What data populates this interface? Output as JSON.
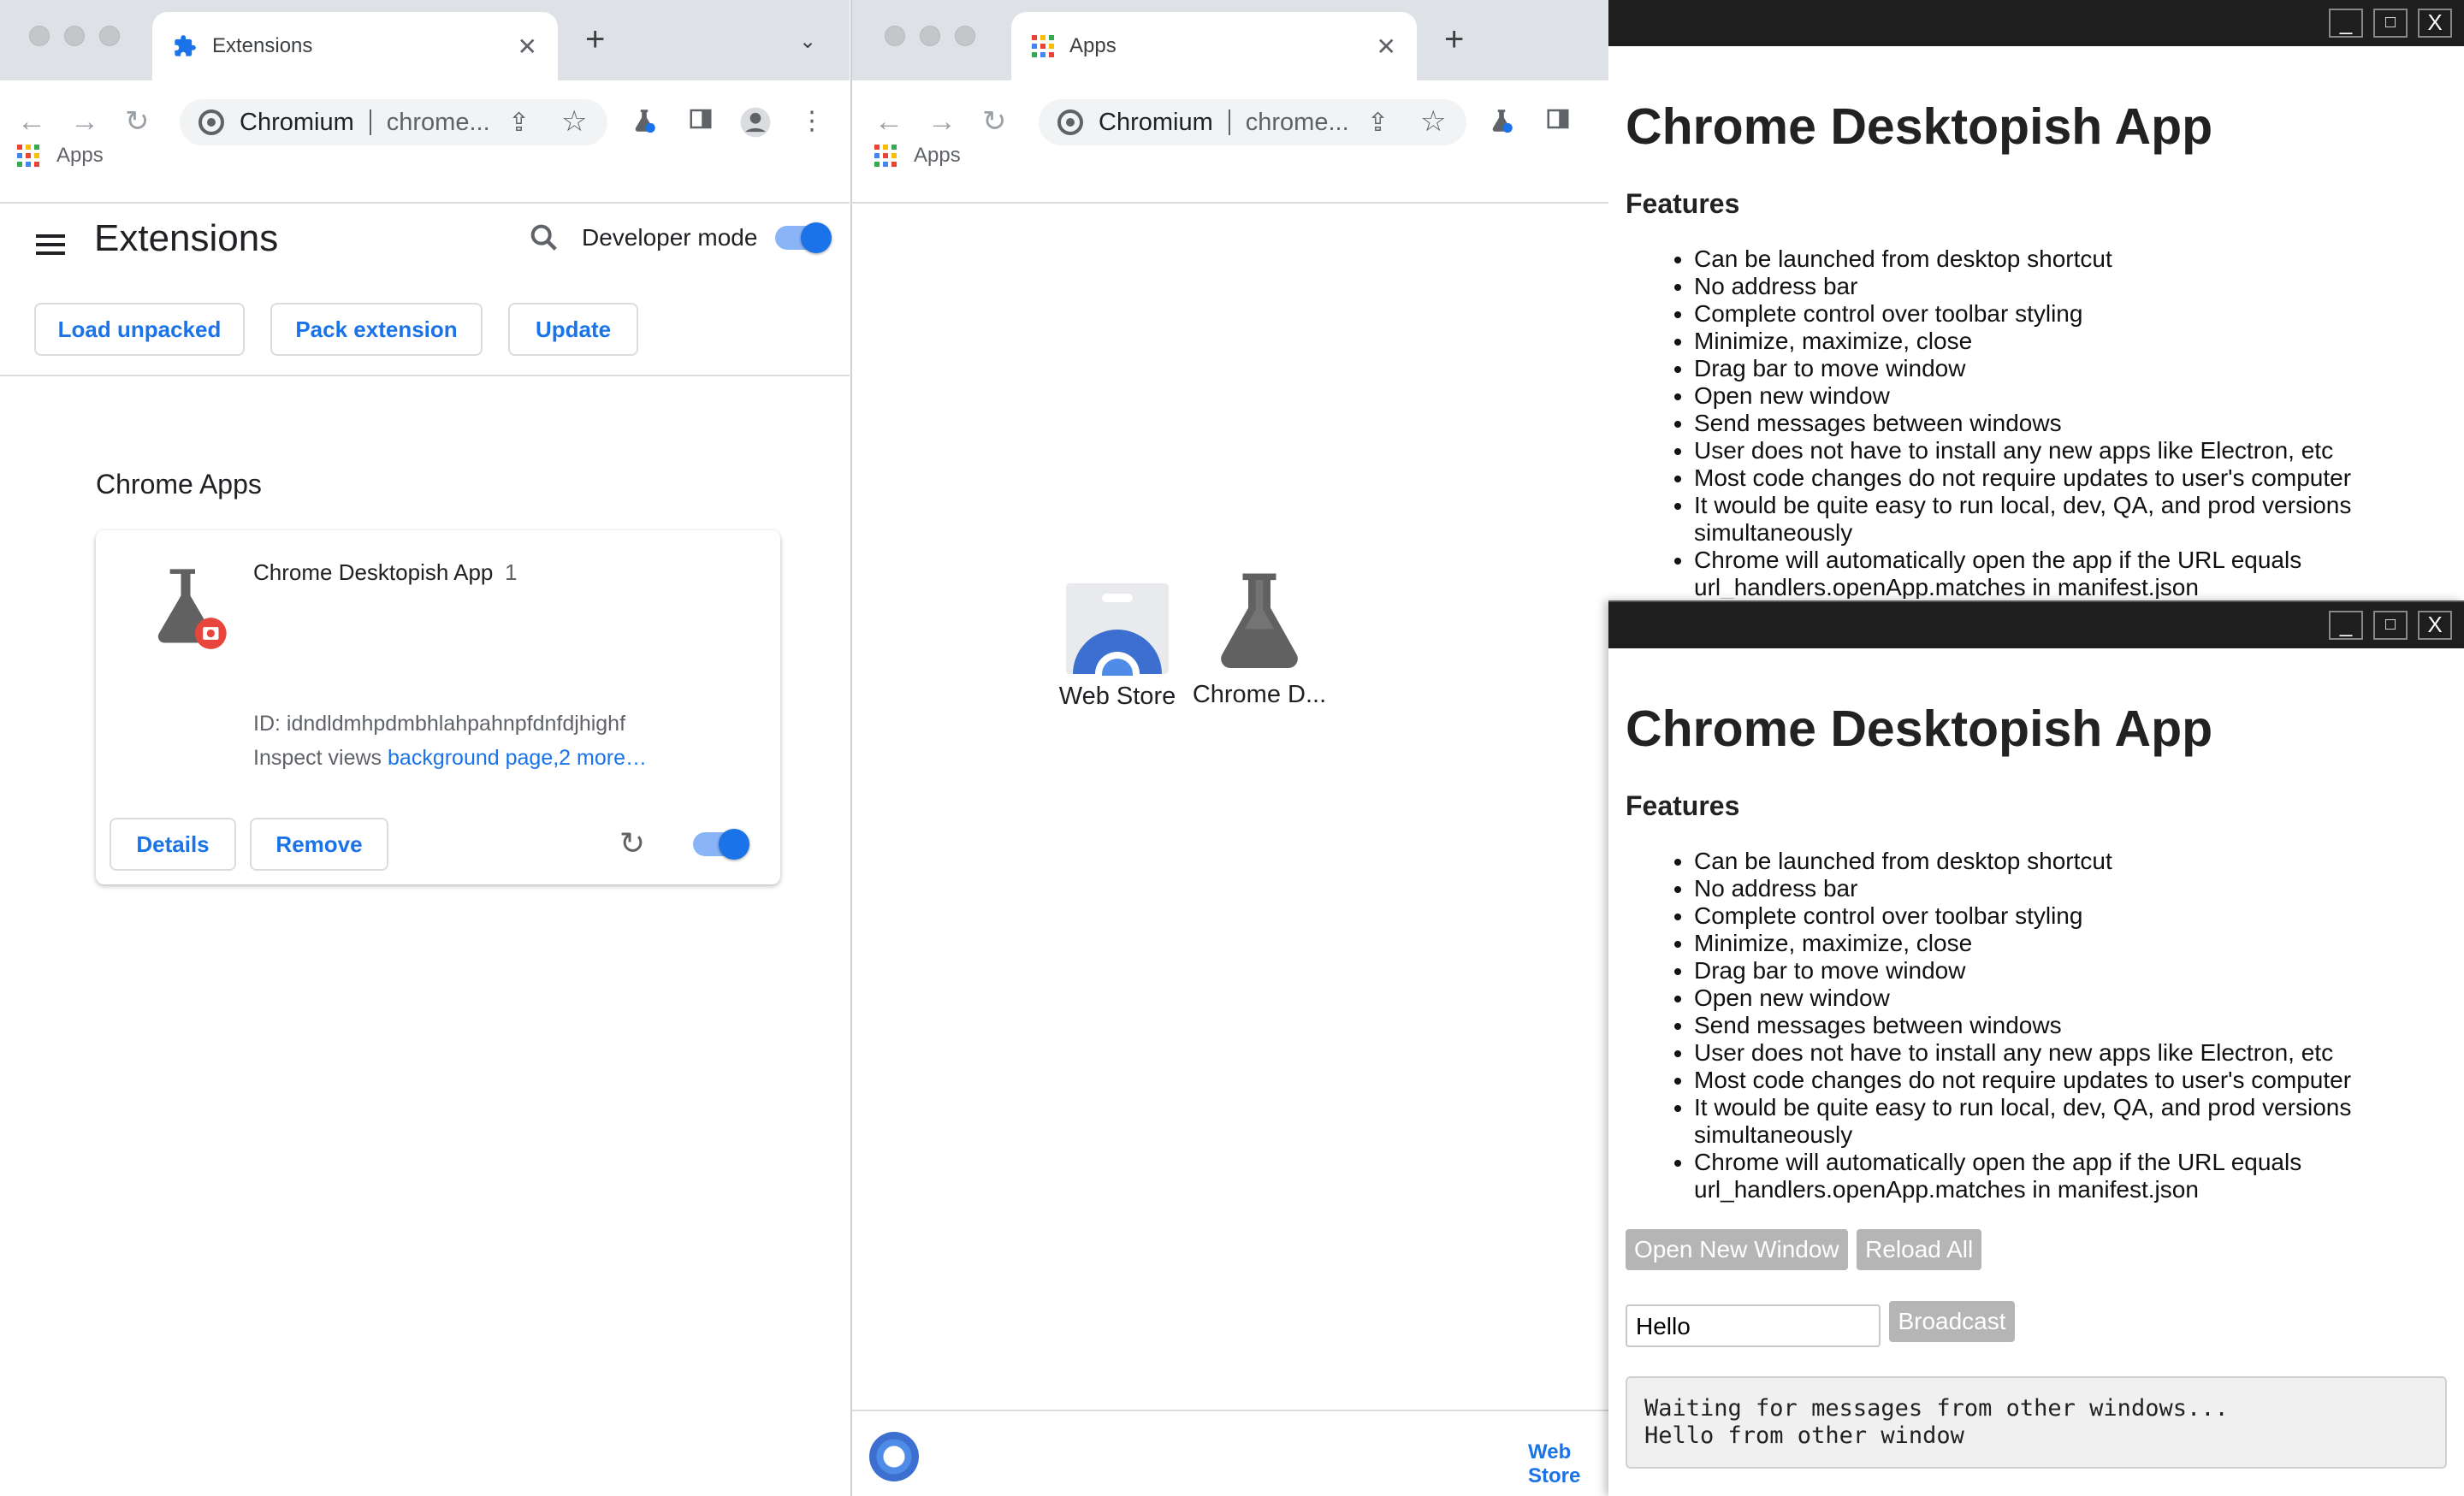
{
  "ext_window": {
    "tab_title": "Extensions",
    "omnibox_host": "Chromium",
    "omnibox_url": "chrome...",
    "bookmark_apps": "Apps",
    "page_title": "Extensions",
    "developer_mode_label": "Developer mode",
    "developer_mode_on": true,
    "buttons": {
      "load_unpacked": "Load unpacked",
      "pack_extension": "Pack extension",
      "update": "Update"
    },
    "section_title": "Chrome Apps",
    "card": {
      "name": "Chrome Desktopish App",
      "version": "1",
      "id_text": "ID: idndldmhpdmbhlahpahnpfdnfdjhighf",
      "inspect_label": "Inspect views",
      "inspect_link": "background page,2 more…",
      "details": "Details",
      "remove": "Remove",
      "enabled": true
    }
  },
  "apps_window": {
    "tab_title": "Apps",
    "omnibox_host": "Chromium",
    "omnibox_url": "chrome...",
    "bookmark_apps": "Apps",
    "apps": [
      {
        "label": "Web Store",
        "icon": "web-store-icon"
      },
      {
        "label": "Chrome D...",
        "icon": "flask-icon"
      }
    ],
    "shelf_link": "Web Store"
  },
  "app_window_1": {
    "controls": {
      "minimize": "_",
      "maximize": "□",
      "close": "X"
    },
    "heading": "Chrome Desktopish App",
    "subheading": "Features",
    "features": [
      "Can be launched from desktop shortcut",
      "No address bar",
      "Complete control over toolbar styling",
      "Minimize, maximize, close",
      "Drag bar to move window",
      "Open new window",
      "Send messages between windows",
      "User does not have to install any new apps like Electron, etc",
      "Most code changes do not require updates to user's computer",
      "It would be quite easy to run local, dev, QA, and prod versions simultaneously",
      "Chrome will automatically open the app if the URL equals url_handlers.openApp.matches in manifest.json"
    ]
  },
  "app_window_2": {
    "controls": {
      "minimize": "_",
      "maximize": "□",
      "close": "X"
    },
    "heading": "Chrome Desktopish App",
    "subheading": "Features",
    "features": [
      "Can be launched from desktop shortcut",
      "No address bar",
      "Complete control over toolbar styling",
      "Minimize, maximize, close",
      "Drag bar to move window",
      "Open new window",
      "Send messages between windows",
      "User does not have to install any new apps like Electron, etc",
      "Most code changes do not require updates to user's computer",
      "It would be quite easy to run local, dev, QA, and prod versions simultaneously",
      "Chrome will automatically open the app if the URL equals url_handlers.openApp.matches in manifest.json"
    ],
    "open_new_window": "Open New Window",
    "reload_all": "Reload All",
    "message_value": "Hello",
    "broadcast": "Broadcast",
    "log_lines": "Waiting for messages from other windows...\nHello from other window"
  },
  "colors": {
    "accent": "#1a73e8",
    "tabstrip": "#dee1e6",
    "app_titlebar": "#1e1e1e",
    "badge_red": "#e8453c"
  }
}
